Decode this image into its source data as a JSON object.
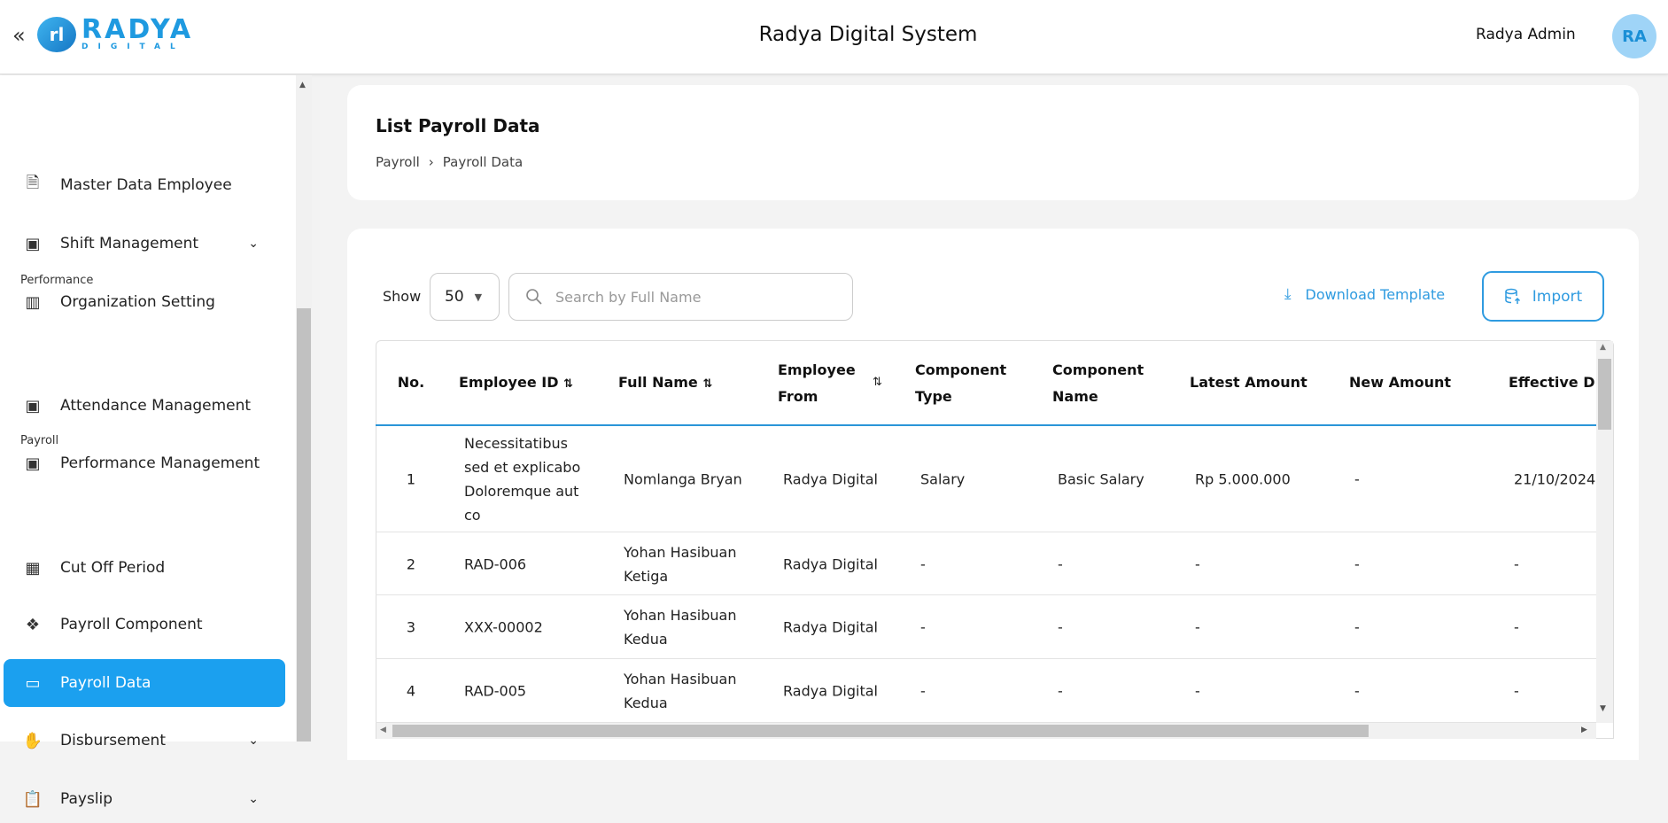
{
  "header": {
    "title": "Radya Digital System",
    "user_name": "Radya Admin",
    "avatar_initials": "RA",
    "logo_text": "RADYA",
    "logo_sub": "DIGITAL"
  },
  "colors": {
    "accent": "#1ba0ef",
    "avatar_bg": "#9fd4f7"
  },
  "sidebar": {
    "items": [
      {
        "label": "Master Data Employee",
        "icon": "document-icon"
      },
      {
        "label": "Shift Management",
        "icon": "grid-icon",
        "chevron": true
      },
      {
        "label": "Organization Setting",
        "icon": "building-icon"
      },
      {
        "label": "Attendance Management",
        "icon": "grid-icon"
      },
      {
        "label": "Performance Management",
        "icon": "grid-icon"
      },
      {
        "label": "Cut Off Period",
        "icon": "calendar-icon"
      },
      {
        "label": "Payroll Component",
        "icon": "components-icon"
      },
      {
        "label": "Payroll Data",
        "icon": "wallet-icon",
        "active": true
      },
      {
        "label": "Disbursement",
        "icon": "hand-coin-icon",
        "chevron": true
      },
      {
        "label": "Payslip",
        "icon": "clipboard-icon",
        "chevron": true
      }
    ],
    "sections": [
      "Performance",
      "Payroll"
    ]
  },
  "page": {
    "title": "List Payroll Data",
    "breadcrumb": [
      "Payroll",
      "Payroll Data"
    ]
  },
  "toolbar": {
    "show_label": "Show",
    "page_size": "50",
    "search_placeholder": "Search by Full Name",
    "download_label": "Download Template",
    "import_label": "Import"
  },
  "table": {
    "columns": [
      "No.",
      "Employee ID",
      "Full Name",
      "Employee From",
      "Component Type",
      "Component Name",
      "Latest Amount",
      "New Amount",
      "Effective D"
    ],
    "col_lines": {
      "emp_from": [
        "Employee",
        "From"
      ],
      "comp_type": [
        "Component",
        "Type"
      ],
      "comp_name": [
        "Component",
        "Name"
      ]
    },
    "rows": [
      [
        "1",
        "Necessitatibus sed et explicabo Doloremque aut co",
        "Nomlanga Bryan",
        "Radya Digital",
        "Salary",
        "Basic Salary",
        "Rp 5.000.000",
        "-",
        "21/10/2024"
      ],
      [
        "2",
        "RAD-006",
        "Yohan Hasibuan Ketiga",
        "Radya Digital",
        "-",
        "-",
        "-",
        "-",
        "-"
      ],
      [
        "3",
        "XXX-00002",
        "Yohan Hasibuan Kedua",
        "Radya Digital",
        "-",
        "-",
        "-",
        "-",
        "-"
      ],
      [
        "4",
        "RAD-005",
        "Yohan Hasibuan Kedua",
        "Radya Digital",
        "-",
        "-",
        "-",
        "-",
        "-"
      ]
    ]
  }
}
